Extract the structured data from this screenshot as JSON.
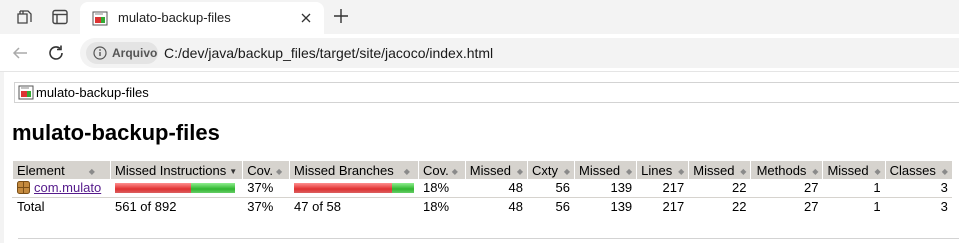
{
  "browser": {
    "tab": {
      "title": "mulato-backup-files"
    },
    "address": {
      "chip_label": "Arquivo",
      "url": "C:/dev/java/backup_files/target/site/jacoco/index.html"
    }
  },
  "page": {
    "breadcrumb": "mulato-backup-files",
    "title": "mulato-backup-files"
  },
  "table": {
    "headers": {
      "element": "Element",
      "missed_instructions": "Missed Instructions",
      "cov1": "Cov.",
      "missed_branches": "Missed Branches",
      "cov2": "Cov.",
      "missed_cxty": "Missed",
      "cxty": "Cxty",
      "missed_lines": "Missed",
      "lines": "Lines",
      "missed_methods": "Missed",
      "methods": "Methods",
      "missed_classes": "Missed",
      "classes": "Classes"
    },
    "rows": [
      {
        "element": "com.mulato",
        "instructions_covered_fraction": 0.37,
        "cov1": "37%",
        "branches_covered_fraction": 0.18,
        "cov2": "18%",
        "missed_cxty": "48",
        "cxty": "56",
        "missed_lines": "139",
        "lines": "217",
        "missed_methods": "22",
        "methods": "27",
        "missed_classes": "1",
        "classes": "3"
      }
    ],
    "total": {
      "label": "Total",
      "instructions": "561 of 892",
      "cov1": "37%",
      "branches": "47 of 58",
      "cov2": "18%",
      "missed_cxty": "48",
      "cxty": "56",
      "missed_lines": "139",
      "lines": "217",
      "missed_methods": "22",
      "methods": "27",
      "missed_classes": "1",
      "classes": "3"
    }
  },
  "icons": {
    "tab_actions": "tab-actions-icon",
    "vertical_tabs": "vertical-tabs-icon",
    "favicon": "report-favicon-icon",
    "close": "close-icon",
    "new_tab": "plus-icon",
    "back": "back-arrow-icon",
    "reload": "reload-icon",
    "info": "info-icon",
    "package": "package-icon"
  },
  "colors": {
    "missed_bar": "#e03030",
    "covered_bar": "#2fb62f",
    "header_bg": "#d6d3ce",
    "link": "#551a8b"
  }
}
